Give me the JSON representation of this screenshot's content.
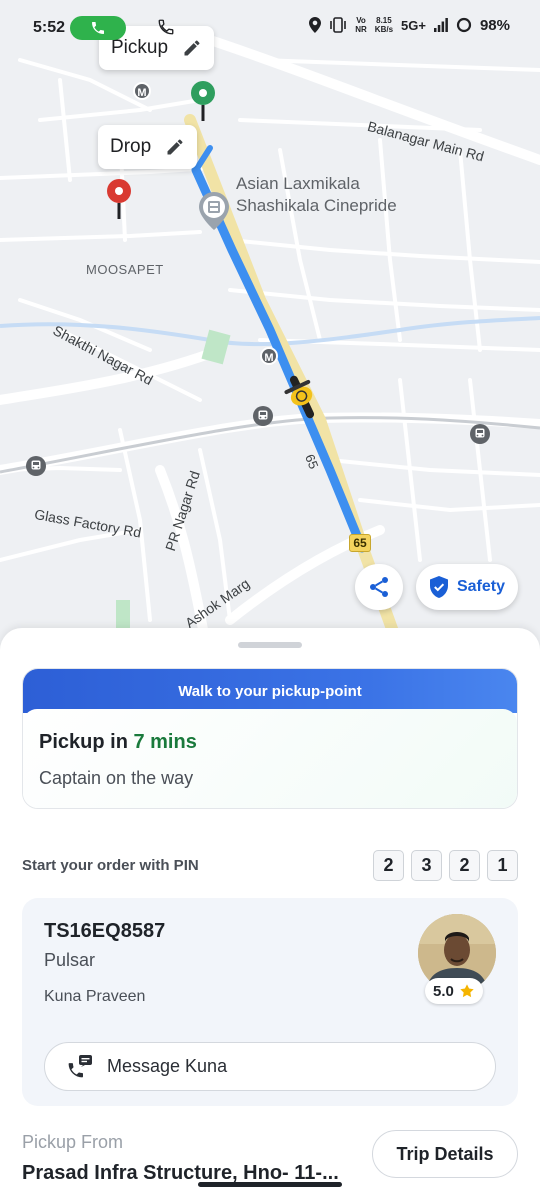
{
  "status_bar": {
    "time": "5:52",
    "net_left": "Vo",
    "net_right": "NR",
    "speed_value": "8.15",
    "speed_unit": "KB/s",
    "network": "5G+",
    "battery": "98%"
  },
  "map": {
    "pickup_chip": "Pickup",
    "drop_chip": "Drop",
    "labels": {
      "balanagar": "Balanagar Main Rd",
      "cinema_line1": "Asian Laxmikala",
      "cinema_line2": "Shashikala Cinepride",
      "moosapet": "MOOSAPET",
      "shakthi": "Shakthi Nagar Rd",
      "glass": "Glass Factory Rd",
      "pr_nagar": "PR Nagar Rd",
      "ashok": "Ashok Marg",
      "hwy_label": "65",
      "hwy_badge": "65",
      "metro": "M"
    },
    "share_icon": "share-icon",
    "safety_label": "Safety",
    "colors": {
      "route": "#3d8ff0",
      "pickup_pin": "#2e9e5e",
      "drop_pin": "#d93a32",
      "highway": "#f1e3a6"
    }
  },
  "sheet": {
    "banner": "Walk to your pickup-point",
    "eta_prefix": "Pickup in ",
    "eta_mins": "7 mins",
    "eta_sub": "Captain on the way",
    "pin_label": "Start your order with PIN",
    "pin_digits": [
      "2",
      "3",
      "2",
      "1"
    ],
    "captain": {
      "plate": "TS16EQ8587",
      "vehicle": "Pulsar",
      "name": "Kuna Praveen",
      "rating": "5.0",
      "message_label": "Message Kuna"
    },
    "pickup_from_label": "Pickup From",
    "pickup_from_value": "Prasad Infra Structure, Hno- 11-...",
    "trip_details": "Trip Details"
  }
}
